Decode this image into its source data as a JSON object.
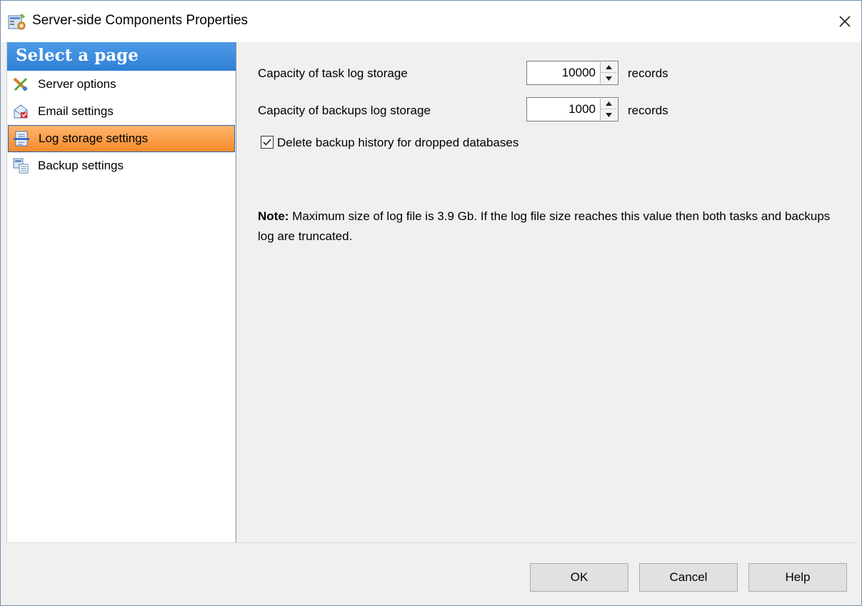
{
  "window": {
    "title": "Server-side Components Properties",
    "title_icon": "properties-icon"
  },
  "sidebar": {
    "header": "Select a page",
    "items": [
      {
        "label": "Server options",
        "icon": "server-options-icon"
      },
      {
        "label": "Email settings",
        "icon": "email-icon"
      },
      {
        "label": "Log storage settings",
        "icon": "log-storage-icon",
        "selected": true
      },
      {
        "label": "Backup settings",
        "icon": "backup-icon"
      }
    ]
  },
  "content": {
    "task_log": {
      "label": "Capacity of task log storage",
      "value": "10000",
      "unit": "records"
    },
    "backups_log": {
      "label": "Capacity of backups log storage",
      "value": "1000",
      "unit": "records"
    },
    "delete_history": {
      "label": "Delete backup history for dropped databases",
      "checked": true
    },
    "note": {
      "prefix": "Note:",
      "text": " Maximum size of log file is 3.9 Gb. If the log file size reaches this value then both tasks and backups log are truncated."
    }
  },
  "buttons": {
    "ok": "OK",
    "cancel": "Cancel",
    "help": "Help"
  },
  "colors": {
    "header_blue": "#2f7fd6",
    "selected_orange": "#f58a2b"
  }
}
